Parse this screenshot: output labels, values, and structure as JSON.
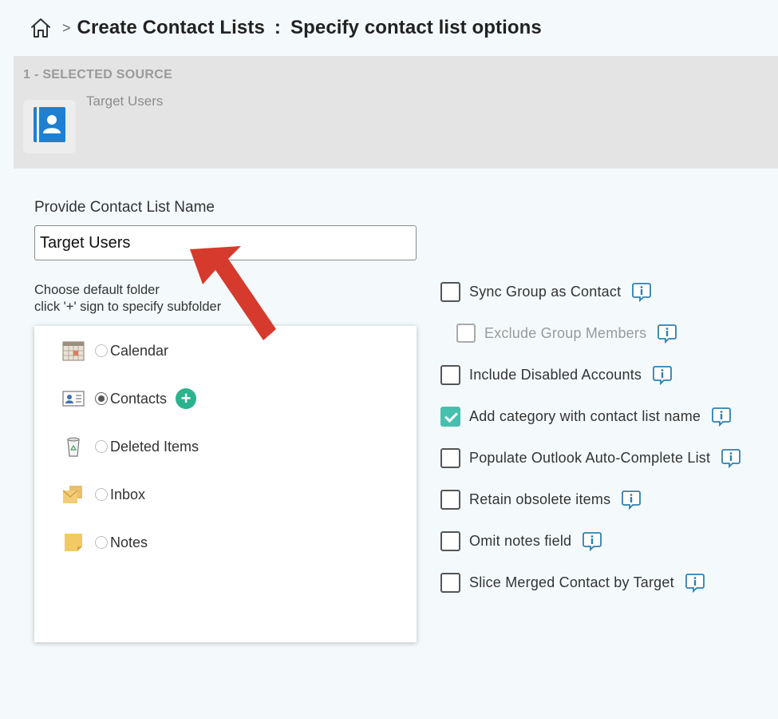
{
  "header": {
    "breadcrumb_separator": ">",
    "title_main": "Create Contact Lists",
    "title_separator": ":",
    "title_step": "Specify contact list options"
  },
  "source": {
    "section_label": "1 - SELECTED SOURCE",
    "name": "Target Users",
    "icon": "contact-book-icon"
  },
  "name_field": {
    "label": "Provide Contact List Name",
    "value": "Target Users"
  },
  "folder_hint": {
    "line1": "Choose default folder",
    "line2": "click '+' sign to specify subfolder"
  },
  "folders": [
    {
      "name": "Calendar",
      "icon": "calendar-icon",
      "selected": false
    },
    {
      "name": "Contacts",
      "icon": "contacts-card-icon",
      "selected": true,
      "add_label": "+"
    },
    {
      "name": "Deleted Items",
      "icon": "trash-icon",
      "selected": false
    },
    {
      "name": "Inbox",
      "icon": "inbox-folder-icon",
      "selected": false
    },
    {
      "name": "Notes",
      "icon": "sticky-note-icon",
      "selected": false
    }
  ],
  "options": [
    {
      "label": "Sync Group as Contact",
      "checked": false,
      "disabled": false
    },
    {
      "label": "Exclude Group Members",
      "checked": false,
      "disabled": true
    },
    {
      "label": "Include Disabled Accounts",
      "checked": false,
      "disabled": false
    },
    {
      "label": "Add category with contact list name",
      "checked": true,
      "disabled": false
    },
    {
      "label": "Populate Outlook Auto-Complete List",
      "checked": false,
      "disabled": false
    },
    {
      "label": "Retain obsolete items",
      "checked": false,
      "disabled": false
    },
    {
      "label": "Omit notes field",
      "checked": false,
      "disabled": false
    },
    {
      "label": "Slice Merged Contact by Target",
      "checked": false,
      "disabled": false
    }
  ],
  "colors": {
    "accent_teal": "#46c0ae",
    "add_green": "#2bb38e",
    "info_blue": "#2f7fb0",
    "arrow_red": "#d63a2c",
    "contact_blue": "#1f7fd0"
  }
}
